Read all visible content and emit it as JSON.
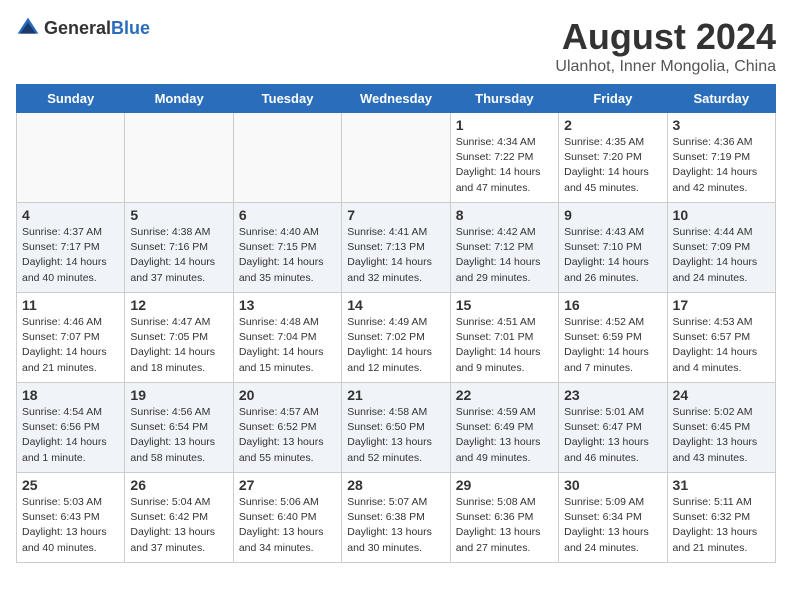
{
  "header": {
    "logo_general": "General",
    "logo_blue": "Blue",
    "title": "August 2024",
    "subtitle": "Ulanhot, Inner Mongolia, China"
  },
  "days_of_week": [
    "Sunday",
    "Monday",
    "Tuesday",
    "Wednesday",
    "Thursday",
    "Friday",
    "Saturday"
  ],
  "weeks": [
    {
      "days": [
        {
          "num": "",
          "info": ""
        },
        {
          "num": "",
          "info": ""
        },
        {
          "num": "",
          "info": ""
        },
        {
          "num": "",
          "info": ""
        },
        {
          "num": "1",
          "info": "Sunrise: 4:34 AM\nSunset: 7:22 PM\nDaylight: 14 hours\nand 47 minutes."
        },
        {
          "num": "2",
          "info": "Sunrise: 4:35 AM\nSunset: 7:20 PM\nDaylight: 14 hours\nand 45 minutes."
        },
        {
          "num": "3",
          "info": "Sunrise: 4:36 AM\nSunset: 7:19 PM\nDaylight: 14 hours\nand 42 minutes."
        }
      ]
    },
    {
      "days": [
        {
          "num": "4",
          "info": "Sunrise: 4:37 AM\nSunset: 7:17 PM\nDaylight: 14 hours\nand 40 minutes."
        },
        {
          "num": "5",
          "info": "Sunrise: 4:38 AM\nSunset: 7:16 PM\nDaylight: 14 hours\nand 37 minutes."
        },
        {
          "num": "6",
          "info": "Sunrise: 4:40 AM\nSunset: 7:15 PM\nDaylight: 14 hours\nand 35 minutes."
        },
        {
          "num": "7",
          "info": "Sunrise: 4:41 AM\nSunset: 7:13 PM\nDaylight: 14 hours\nand 32 minutes."
        },
        {
          "num": "8",
          "info": "Sunrise: 4:42 AM\nSunset: 7:12 PM\nDaylight: 14 hours\nand 29 minutes."
        },
        {
          "num": "9",
          "info": "Sunrise: 4:43 AM\nSunset: 7:10 PM\nDaylight: 14 hours\nand 26 minutes."
        },
        {
          "num": "10",
          "info": "Sunrise: 4:44 AM\nSunset: 7:09 PM\nDaylight: 14 hours\nand 24 minutes."
        }
      ]
    },
    {
      "days": [
        {
          "num": "11",
          "info": "Sunrise: 4:46 AM\nSunset: 7:07 PM\nDaylight: 14 hours\nand 21 minutes."
        },
        {
          "num": "12",
          "info": "Sunrise: 4:47 AM\nSunset: 7:05 PM\nDaylight: 14 hours\nand 18 minutes."
        },
        {
          "num": "13",
          "info": "Sunrise: 4:48 AM\nSunset: 7:04 PM\nDaylight: 14 hours\nand 15 minutes."
        },
        {
          "num": "14",
          "info": "Sunrise: 4:49 AM\nSunset: 7:02 PM\nDaylight: 14 hours\nand 12 minutes."
        },
        {
          "num": "15",
          "info": "Sunrise: 4:51 AM\nSunset: 7:01 PM\nDaylight: 14 hours\nand 9 minutes."
        },
        {
          "num": "16",
          "info": "Sunrise: 4:52 AM\nSunset: 6:59 PM\nDaylight: 14 hours\nand 7 minutes."
        },
        {
          "num": "17",
          "info": "Sunrise: 4:53 AM\nSunset: 6:57 PM\nDaylight: 14 hours\nand 4 minutes."
        }
      ]
    },
    {
      "days": [
        {
          "num": "18",
          "info": "Sunrise: 4:54 AM\nSunset: 6:56 PM\nDaylight: 14 hours\nand 1 minute."
        },
        {
          "num": "19",
          "info": "Sunrise: 4:56 AM\nSunset: 6:54 PM\nDaylight: 13 hours\nand 58 minutes."
        },
        {
          "num": "20",
          "info": "Sunrise: 4:57 AM\nSunset: 6:52 PM\nDaylight: 13 hours\nand 55 minutes."
        },
        {
          "num": "21",
          "info": "Sunrise: 4:58 AM\nSunset: 6:50 PM\nDaylight: 13 hours\nand 52 minutes."
        },
        {
          "num": "22",
          "info": "Sunrise: 4:59 AM\nSunset: 6:49 PM\nDaylight: 13 hours\nand 49 minutes."
        },
        {
          "num": "23",
          "info": "Sunrise: 5:01 AM\nSunset: 6:47 PM\nDaylight: 13 hours\nand 46 minutes."
        },
        {
          "num": "24",
          "info": "Sunrise: 5:02 AM\nSunset: 6:45 PM\nDaylight: 13 hours\nand 43 minutes."
        }
      ]
    },
    {
      "days": [
        {
          "num": "25",
          "info": "Sunrise: 5:03 AM\nSunset: 6:43 PM\nDaylight: 13 hours\nand 40 minutes."
        },
        {
          "num": "26",
          "info": "Sunrise: 5:04 AM\nSunset: 6:42 PM\nDaylight: 13 hours\nand 37 minutes."
        },
        {
          "num": "27",
          "info": "Sunrise: 5:06 AM\nSunset: 6:40 PM\nDaylight: 13 hours\nand 34 minutes."
        },
        {
          "num": "28",
          "info": "Sunrise: 5:07 AM\nSunset: 6:38 PM\nDaylight: 13 hours\nand 30 minutes."
        },
        {
          "num": "29",
          "info": "Sunrise: 5:08 AM\nSunset: 6:36 PM\nDaylight: 13 hours\nand 27 minutes."
        },
        {
          "num": "30",
          "info": "Sunrise: 5:09 AM\nSunset: 6:34 PM\nDaylight: 13 hours\nand 24 minutes."
        },
        {
          "num": "31",
          "info": "Sunrise: 5:11 AM\nSunset: 6:32 PM\nDaylight: 13 hours\nand 21 minutes."
        }
      ]
    }
  ]
}
